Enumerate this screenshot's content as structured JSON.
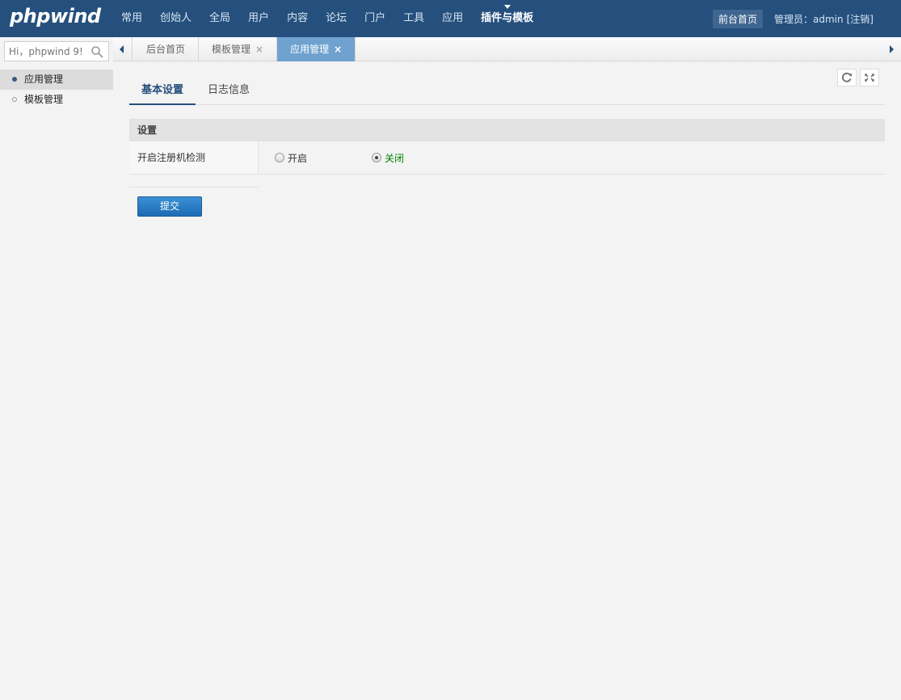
{
  "header": {
    "logo": "phpwind",
    "nav": [
      {
        "label": "常用",
        "active": false
      },
      {
        "label": "创始人",
        "active": false
      },
      {
        "label": "全局",
        "active": false
      },
      {
        "label": "用户",
        "active": false
      },
      {
        "label": "内容",
        "active": false
      },
      {
        "label": "论坛",
        "active": false
      },
      {
        "label": "门户",
        "active": false
      },
      {
        "label": "工具",
        "active": false
      },
      {
        "label": "应用",
        "active": false
      },
      {
        "label": "插件与模板",
        "active": true
      }
    ],
    "front_link": "前台首页",
    "admin_label": "管理员：",
    "admin_name": "admin",
    "logout": "[注销]"
  },
  "sidebar": {
    "search_placeholder": "Hi，phpwind 9!",
    "items": [
      {
        "label": "应用管理",
        "active": true
      },
      {
        "label": "模板管理",
        "active": false
      }
    ]
  },
  "tabbar": {
    "tabs": [
      {
        "label": "后台首页",
        "closable": false,
        "active": false
      },
      {
        "label": "模板管理",
        "closable": true,
        "active": false
      },
      {
        "label": "应用管理",
        "closable": true,
        "active": true
      }
    ],
    "close_glyph": "×"
  },
  "content": {
    "subtabs": [
      {
        "label": "基本设置",
        "active": true
      },
      {
        "label": "日志信息",
        "active": false
      }
    ],
    "section_title": "设置",
    "row_label": "开启注册机检测",
    "options": [
      {
        "label": "开启",
        "checked": false
      },
      {
        "label": "关闭",
        "checked": true
      }
    ],
    "submit_label": "提交"
  },
  "colors": {
    "header_bg": "#25507d",
    "active_tab": "#6fa2cf",
    "submit_btn": "#1e6cb3",
    "selected_option_text": "#008000"
  }
}
